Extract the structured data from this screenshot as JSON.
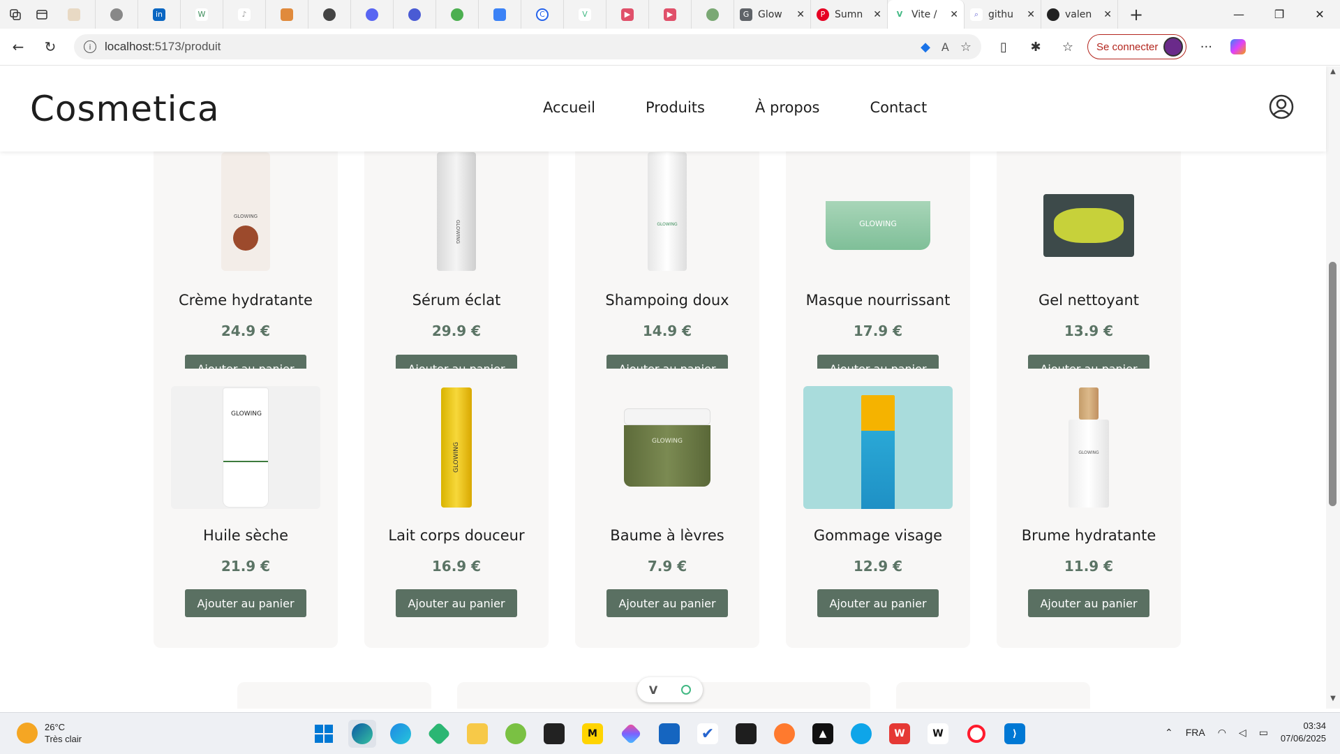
{
  "browser": {
    "tabs": [
      {
        "title": "Glow",
        "favicon": "g-icon",
        "color": "#5f6368"
      },
      {
        "title": "Sumn",
        "favicon": "pinterest-icon",
        "color": "#e60023"
      },
      {
        "title": "Vite /",
        "favicon": "vue-icon",
        "color": "#41b883",
        "active": true
      },
      {
        "title": "githu",
        "favicon": "search-icon",
        "color": "#6b6bd6"
      },
      {
        "title": "valen",
        "favicon": "github-icon",
        "color": "#222222"
      }
    ],
    "address": {
      "host": "localhost:",
      "path": "5173/produit"
    },
    "signin_label": "Se connecter"
  },
  "site": {
    "logo": "Cosmetica",
    "nav": [
      "Accueil",
      "Produits",
      "À propos",
      "Contact"
    ]
  },
  "products_row1": [
    {
      "name": "Crème hydratante",
      "price": "24.9 €",
      "button": "Ajouter au panier"
    },
    {
      "name": "Sérum éclat",
      "price": "29.9 €",
      "button": "Ajouter au panier"
    },
    {
      "name": "Shampoing doux",
      "price": "14.9 €",
      "button": "Ajouter au panier"
    },
    {
      "name": "Masque nourrissant",
      "price": "17.9 €",
      "button": "Ajouter au panier"
    },
    {
      "name": "Gel nettoyant",
      "price": "13.9 €",
      "button": "Ajouter au panier"
    }
  ],
  "products_row2": [
    {
      "name": "Huile sèche",
      "price": "21.9 €",
      "button": "Ajouter au panier"
    },
    {
      "name": "Lait corps douceur",
      "price": "16.9 €",
      "button": "Ajouter au panier"
    },
    {
      "name": "Baume à lèvres",
      "price": "7.9 €",
      "button": "Ajouter au panier"
    },
    {
      "name": "Gommage visage",
      "price": "12.9 €",
      "button": "Ajouter au panier"
    },
    {
      "name": "Brume hydratante",
      "price": "11.9 €",
      "button": "Ajouter au panier"
    }
  ],
  "product_image_text": "GLOWING",
  "colors": {
    "accent": "#5a7062",
    "price": "#5b7465",
    "card_bg": "#f8f7f6"
  },
  "taskbar": {
    "weather_temp": "26°C",
    "weather_desc": "Très clair",
    "lang": "FRA",
    "time": "03:34",
    "date": "07/06/2025"
  }
}
